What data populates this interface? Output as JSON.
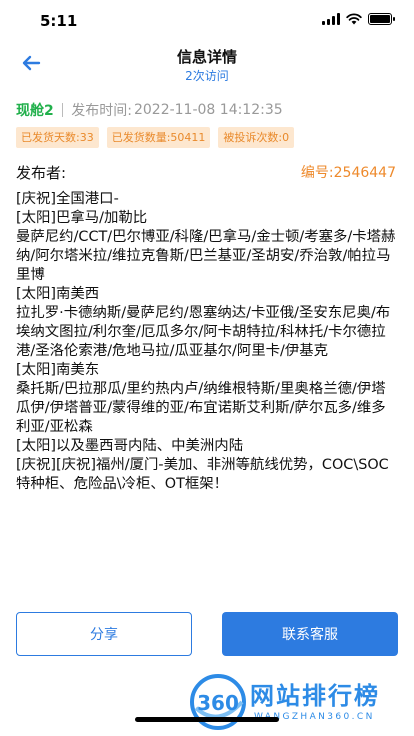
{
  "status": {
    "time": "5:11"
  },
  "nav": {
    "title": "信息详情",
    "subtitle": "2次访问"
  },
  "meta": {
    "author": "现舱2",
    "publish_label": "发布时间:",
    "publish_time": "2022-11-08 14:12:35"
  },
  "badges": [
    {
      "label": "已发货天数:33"
    },
    {
      "label": "已发货数量:50411"
    },
    {
      "label": "被投诉次数:0"
    }
  ],
  "publisher": {
    "label": "发布者:",
    "id_text": "编号:2546447"
  },
  "content": {
    "lines": [
      "[庆祝]全国港口-",
      "[太阳]巴拿马/加勒比",
      "曼萨尼约/CCT/巴尔博亚/科隆/巴拿马/金士顿/考塞多/卡塔赫纳/阿尔塔米拉/维拉克鲁斯/巴兰基亚/圣胡安/乔治敦/帕拉马里博",
      "[太阳]南美西",
      "拉扎罗·卡德纳斯/曼萨尼约/恩塞纳达/卡亚俄/圣安东尼奥/布埃纳文图拉/利尔奎/厄瓜多尔/阿卡胡特拉/科林托/卡尔德拉港/圣洛伦索港/危地马拉/瓜亚基尔/阿里卡/伊基克",
      "[太阳]南美东",
      "桑托斯/巴拉那瓜/里约热内卢/纳维根特斯/里奥格兰德/伊塔瓜伊/伊塔普亚/蒙得维的亚/布宜诺斯艾利斯/萨尔瓦多/维多利亚/亚松森",
      "[太阳]以及墨西哥内陆、中美洲内陆",
      "[庆祝][庆祝]福州/厦门-美加、非洲等航线优势，COC\\SOC特种柜、危险品\\冷柜、OT框架！"
    ]
  },
  "actions": {
    "share": "分享",
    "contact": "联系客服"
  },
  "watermark": {
    "logo": "360",
    "text": "网站排行榜",
    "sub": "WANGZHAN360.CN"
  },
  "colors": {
    "accent": "#2d7be0",
    "author": "#21b04b",
    "badge_bg": "#fde7cf",
    "badge_text": "#e98a2c"
  }
}
